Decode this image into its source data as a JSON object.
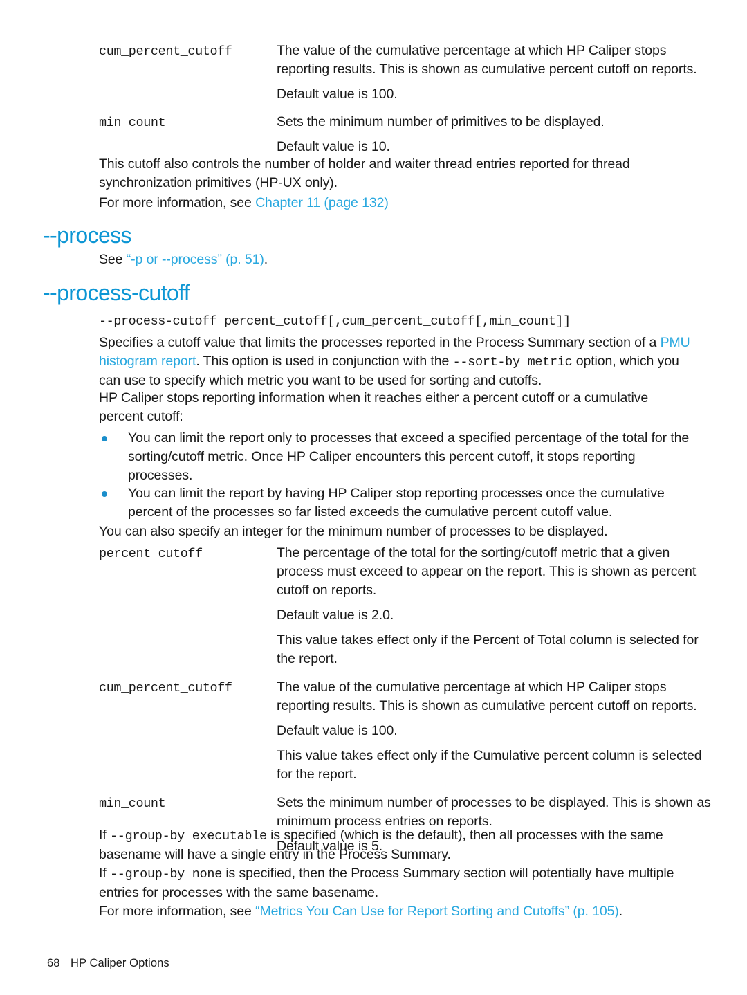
{
  "document": {
    "title": "HP Caliper Options",
    "page_number": "68"
  },
  "colors": {
    "heading_blue": "#0d96d4",
    "link_blue": "#29a8df",
    "bullet_blue": "#1a8ecb",
    "body_text": "#1a1a1a",
    "page_background": "#ffffff"
  },
  "top_definitions": [
    {
      "term": "cum_percent_cutoff",
      "paragraphs": [
        "The value of the cumulative percentage at which HP Caliper stops reporting results. This is shown as cumulative percent cutoff on reports.",
        "Default value is 100."
      ]
    },
    {
      "term": "min_count",
      "paragraphs": [
        "Sets the minimum number of primitives to be displayed.",
        "Default value is 10."
      ]
    }
  ],
  "cutoff_note": "This cutoff also controls the number of holder and waiter thread entries reported for thread synchronization primitives (HP-UX only).",
  "more_info_chapter": {
    "prefix": "For more information, see ",
    "link": "Chapter 11 (page 132)"
  },
  "section_process": {
    "heading": "--process",
    "see_prefix": "See ",
    "see_link": "“-p or --process” (p. 51)",
    "see_suffix": "."
  },
  "section_process_cutoff": {
    "heading": "--process-cutoff",
    "syntax": "--process-cutoff percent_cutoff[,cum_percent_cutoff[,min_count]]",
    "intro": {
      "part1": "Specifies a cutoff value that limits the processes reported in the Process Summary section of a ",
      "link": "PMU histogram report",
      "part2": ". This option is used in conjunction with the ",
      "code": "--sort-by metric",
      "part3": " option, which you can use to specify which metric you want to be used for sorting and cutoffs."
    },
    "stops_paragraph": "HP Caliper stops reporting information when it reaches either a percent cutoff or a cumulative percent cutoff:",
    "bullets": [
      "You can limit the report only to processes that exceed a specified percentage of the total for the sorting/cutoff metric. Once HP Caliper encounters this percent cutoff, it stops reporting processes.",
      "You can limit the report by having HP Caliper stop reporting processes once the cumulative percent of the processes so far listed exceeds the cumulative percent cutoff value."
    ],
    "integer_paragraph": "You can also specify an integer for the minimum number of processes to be displayed.",
    "definitions": [
      {
        "term": "percent_cutoff",
        "paragraphs": [
          "The percentage of the total for the sorting/cutoff metric that a given process must exceed to appear on the report. This is shown as percent cutoff on reports.",
          "Default value is 2.0.",
          "This value takes effect only if the Percent of Total column is selected for the report."
        ]
      },
      {
        "term": "cum_percent_cutoff",
        "paragraphs": [
          "The value of the cumulative percentage at which HP Caliper stops reporting results. This is shown as cumulative percent cutoff on reports.",
          "Default value is 100.",
          "This value takes effect only if the Cumulative percent column is selected for the report."
        ]
      },
      {
        "term": "min_count",
        "paragraphs": [
          "Sets the minimum number of processes to be displayed. This is shown as minimum process entries on reports.",
          "Default value is 5."
        ]
      }
    ],
    "group_by_executable": {
      "part1": "If ",
      "code1": "--group-by executable",
      "part2": " is specified (which is the default), then all processes with the same basename will have a single entry in the Process Summary."
    },
    "group_by_none": {
      "part1": "If ",
      "code1": "--group-by none",
      "part2": " is specified, then the Process Summary section will potentially have multiple entries for processes with the same basename."
    },
    "more_info": {
      "prefix": "For more information, see ",
      "link": "“Metrics You Can Use for Report Sorting and Cutoffs” (p. 105)",
      "suffix": "."
    }
  }
}
